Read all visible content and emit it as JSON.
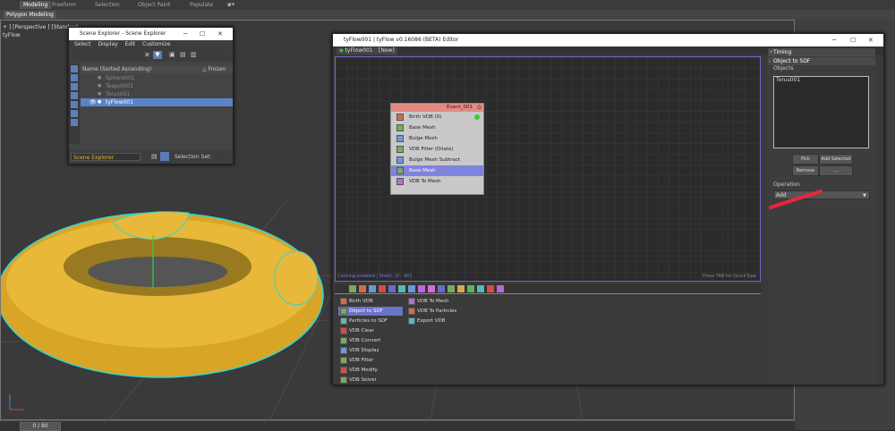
{
  "ribbon": {
    "tabs": [
      "Modeling",
      "Freeform",
      "Selection",
      "Object Paint",
      "Populate"
    ],
    "sub": "Polygon Modeling"
  },
  "viewport": {
    "label": "+ ] [Perspective ] [Standard",
    "sub_label": "tyFlow"
  },
  "timeline": {
    "frame": "0 / 80"
  },
  "scene_explorer": {
    "title": "Scene Explorer - Scene Explorer",
    "menus": [
      "Select",
      "Display",
      "Edit",
      "Customize"
    ],
    "col_name": "Name (Sorted Ascending)",
    "col_frozen": "△ Frozen",
    "rows": [
      "Sphere001",
      "Teapot001",
      "Torus001",
      "tyFlow001"
    ],
    "selected_row": "tyFlow001",
    "footer_dropdown": "Scene Explorer",
    "footer_label": "Selection Set:"
  },
  "tyflow": {
    "title": "tyFlow001 | tyFlow v0.16086 (BETA) Editor",
    "tabs": [
      "tyFlow001",
      "[New]"
    ],
    "event": {
      "name": "Event_001",
      "ops": [
        "Birth VDB (0)",
        "Base Mesh",
        "Bulge Mesh",
        "VDB Filter (Dilate)",
        "Bulge Mesh Subtract",
        "Base Mesh",
        "VDB To Mesh"
      ],
      "selected_index": 5
    },
    "status_left": "Caching enabled | Static: [0 - 80]",
    "status_right": "Press TAB for QuickType",
    "library_col1": [
      "Birth VDB",
      "Object to SDF",
      "Particles to SDF",
      "VDB Clear",
      "VDB Convert",
      "VDB Display",
      "VDB Filter",
      "VDB Modify",
      "VDB Solver"
    ],
    "library_col2": [
      "VDB To Mesh",
      "VDB To Particles",
      "Export VDB"
    ],
    "library_selected": "Object to SDF",
    "panel": {
      "timing": "Timing",
      "section": "Object to SDF",
      "objects_label": "Objects",
      "objects": [
        "Torus001"
      ],
      "pick": "Pick",
      "add_selected": "Add Selected",
      "remove": "Remove",
      "more": "....",
      "operation_label": "Operation",
      "operation_value": "Add"
    }
  },
  "colors": {
    "accent": "#6b73c8",
    "torus": "#e8b83a",
    "annotation": "#e8283a",
    "node_head": "#e48a83"
  }
}
